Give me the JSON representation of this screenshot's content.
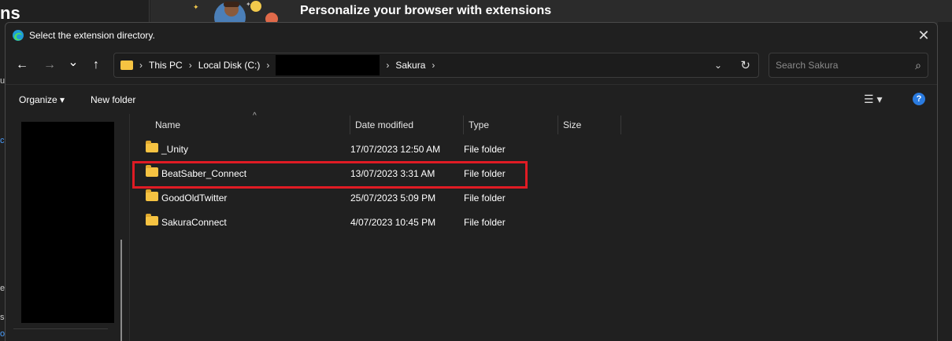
{
  "background": {
    "left_heading": "ns",
    "banner_title": "Personalize your browser with extensions",
    "left_fragments": [
      "ns",
      "us",
      "co",
      "e",
      "s",
      "or"
    ]
  },
  "dialog": {
    "title": "Select the extension directory.",
    "close_glyph": "✕"
  },
  "nav": {
    "back_glyph": "←",
    "forward_glyph": "→",
    "recent_glyph": "⌄",
    "up_glyph": "↑"
  },
  "address": {
    "crumbs": [
      "This PC",
      "Local Disk (C:)",
      "",
      "Sakura"
    ],
    "dropdown_glyph": "⌄",
    "refresh_glyph": "↻"
  },
  "search": {
    "placeholder": "Search Sakura",
    "icon": "⌕"
  },
  "commands": {
    "organize": "Organize ▾",
    "new_folder": "New folder",
    "view_glyph": "☰ ▾",
    "help_glyph": "?"
  },
  "columns": {
    "name": "Name",
    "date": "Date modified",
    "type": "Type",
    "size": "Size",
    "sort_caret": "^"
  },
  "files": [
    {
      "name": "_Unity",
      "date": "17/07/2023 12:50 AM",
      "type": "File folder",
      "size": ""
    },
    {
      "name": "BeatSaber_Connect",
      "date": "13/07/2023 3:31 AM",
      "type": "File folder",
      "size": ""
    },
    {
      "name": "GoodOldTwitter",
      "date": "25/07/2023 5:09 PM",
      "type": "File folder",
      "size": ""
    },
    {
      "name": "SakuraConnect",
      "date": "4/07/2023 10:45 PM",
      "type": "File folder",
      "size": ""
    }
  ],
  "highlight_color": "#e01b24",
  "accent_color": "#2a7be0"
}
